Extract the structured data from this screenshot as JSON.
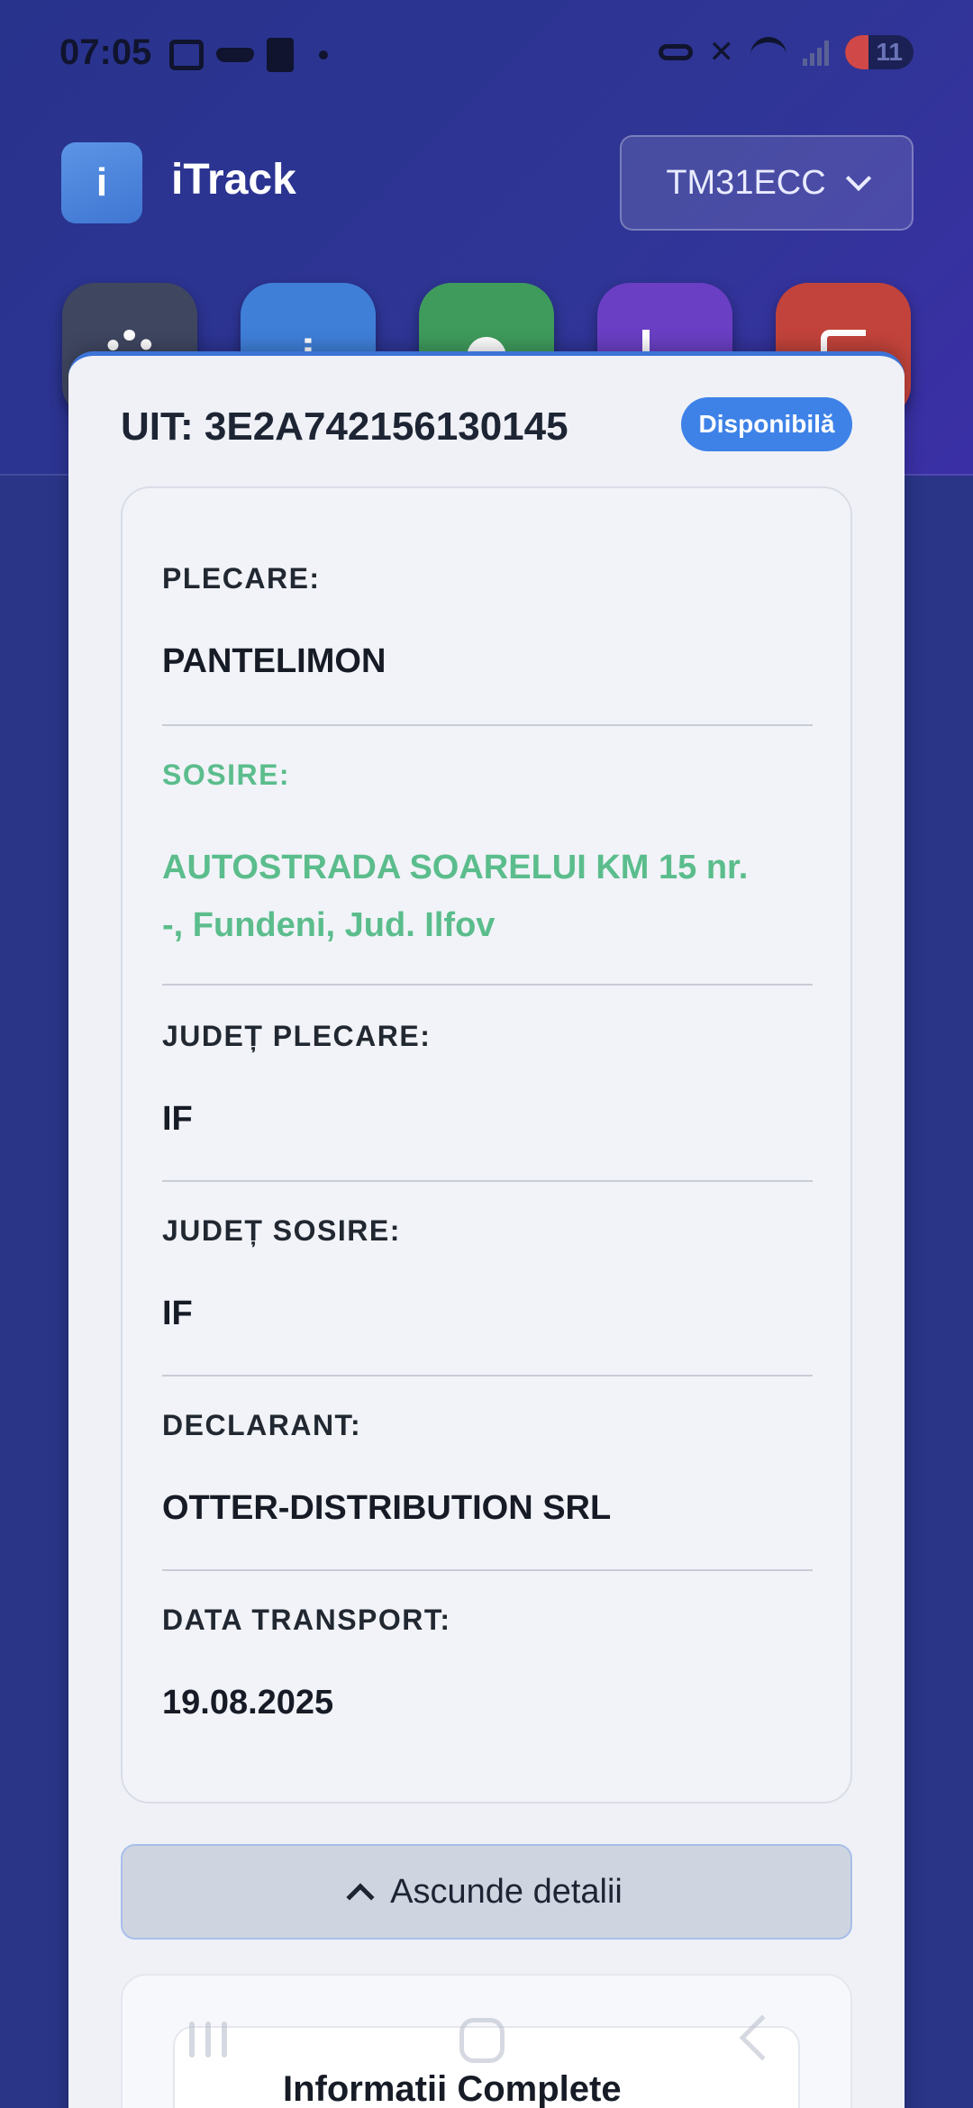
{
  "status_bar": {
    "time": "07:05",
    "battery": "11",
    "icons": [
      "screenshot-icon",
      "glasses-icon",
      "phone-icon",
      "key-icon",
      "mute-icon",
      "wifi-icon",
      "signal-icon",
      "battery-icon"
    ]
  },
  "header": {
    "logo_letter": "i",
    "app_title": "iTrack",
    "vehicle_select": "TM31ECC"
  },
  "actions": [
    {
      "name": "settings",
      "icon": "gear-icon",
      "color": "#3f4660"
    },
    {
      "name": "info",
      "icon": "info-icon",
      "glyph": "i",
      "color": "#3f7fd8"
    },
    {
      "name": "record",
      "icon": "record-icon",
      "color": "#3f9b5c"
    },
    {
      "name": "stats",
      "icon": "chart-icon",
      "color": "#6a3fc4"
    },
    {
      "name": "logout",
      "icon": "logout-icon",
      "color": "#c2433b"
    }
  ],
  "transport": {
    "uit": "UIT: 3E2A742156130145",
    "status_badge": "Disponibilă",
    "fields": {
      "plecare": {
        "label": "PLECARE:",
        "value": "PANTELIMON"
      },
      "sosire": {
        "label": "SOSIRE:",
        "value_line1": "AUTOSTRADA SOARELUI KM 15 nr.",
        "value_line2": "-, Fundeni, Jud. Ilfov"
      },
      "judet_plecare": {
        "label": "JUDEȚ PLECARE:",
        "value": "IF"
      },
      "judet_sosire": {
        "label": "JUDEȚ SOSIRE:",
        "value": "IF"
      },
      "declarant": {
        "label": "DECLARANT:",
        "value": "OTTER-DISTRIBUTION SRL"
      },
      "data_transport": {
        "label": "DATA TRANSPORT:",
        "value": "19.08.2025"
      }
    },
    "toggle_details": "Ascunde detalii",
    "info_title": "Informatii Complete"
  },
  "colors": {
    "accent_blue": "#3e82e8",
    "highlight_green": "#5bbd8c",
    "background": "#2a3587"
  }
}
